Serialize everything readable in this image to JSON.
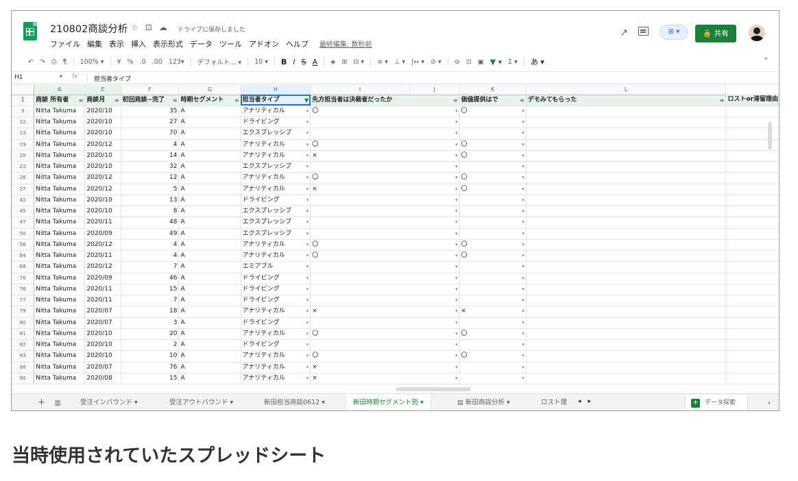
{
  "header": {
    "doc_title": "210802商談分析",
    "saved_note": "ドライブに保存しました",
    "menus": [
      "ファイル",
      "編集",
      "表示",
      "挿入",
      "表示形式",
      "データ",
      "ツール",
      "アドオン",
      "ヘルプ"
    ],
    "last_edit": "最終編集: 数秒前",
    "share_label": "共有",
    "icons": {
      "star": "star-icon",
      "move": "folder-icon",
      "cloud": "cloud-saved-icon",
      "trend": "activity-trend-icon",
      "comment": "comment-icon",
      "present": "present-icon"
    }
  },
  "toolbar": {
    "zoom": "100%",
    "currency": "¥",
    "percent": "%",
    "dec_less": ".0",
    "dec_more": ".00",
    "format": "123",
    "font": "デフォルト...",
    "font_size": "10",
    "bold": "B",
    "italic": "I",
    "strike": "S",
    "text_color": "A",
    "ime": "あ"
  },
  "formula_bar": {
    "cell_ref": "H1",
    "fx": "fx",
    "content": "担当者タイプ"
  },
  "grid": {
    "columns": [
      "A",
      "E",
      "F",
      "G",
      "H",
      "I",
      "J",
      "K",
      "L"
    ],
    "headers": [
      "商談 所有者",
      "商談月",
      "初回商談~完了",
      "時期セグメント",
      "担当者タイプ",
      "先方担当者は決裁者だったか",
      "価値提供はで",
      "デモみてもらった",
      "ロストor滞留理由"
    ],
    "rows": [
      {
        "n": "3",
        "owner": "Nitta Takuma",
        "month": "2020/10",
        "days": "35",
        "seg": "A",
        "type": "アナリティカル",
        "decision": "〇",
        "value": "〇"
      },
      {
        "n": "12",
        "owner": "Nitta Takuma",
        "month": "2020/10",
        "days": "27",
        "seg": "A",
        "type": "ドライビング",
        "decision": "",
        "value": ""
      },
      {
        "n": "13",
        "owner": "Nitta Takuma",
        "month": "2020/10",
        "days": "70",
        "seg": "A",
        "type": "エクスプレッシブ",
        "decision": "",
        "value": ""
      },
      {
        "n": "19",
        "owner": "Nitta Takuma",
        "month": "2020/12",
        "days": "4",
        "seg": "A",
        "type": "アナリティカル",
        "decision": "〇",
        "value": "〇"
      },
      {
        "n": "20",
        "owner": "Nitta Takuma",
        "month": "2020/10",
        "days": "14",
        "seg": "A",
        "type": "アナリティカル",
        "decision": "×",
        "value": "〇"
      },
      {
        "n": "22",
        "owner": "Nitta Takuma",
        "month": "2020/10",
        "days": "32",
        "seg": "A",
        "type": "エクスプレッシブ",
        "decision": "",
        "value": ""
      },
      {
        "n": "26",
        "owner": "Nitta Takuma",
        "month": "2020/12",
        "days": "12",
        "seg": "A",
        "type": "アナリティカル",
        "decision": "〇",
        "value": "〇"
      },
      {
        "n": "27",
        "owner": "Nitta Takuma",
        "month": "2020/12",
        "days": "5",
        "seg": "A",
        "type": "アナリティカル",
        "decision": "×",
        "value": "〇"
      },
      {
        "n": "42",
        "owner": "Nitta Takuma",
        "month": "2020/10",
        "days": "13",
        "seg": "A",
        "type": "ドライビング",
        "decision": "",
        "value": ""
      },
      {
        "n": "45",
        "owner": "Nitta Takuma",
        "month": "2020/10",
        "days": "8",
        "seg": "A",
        "type": "エクスプレッシブ",
        "decision": "",
        "value": ""
      },
      {
        "n": "47",
        "owner": "Nitta Takuma",
        "month": "2020/11",
        "days": "48",
        "seg": "A",
        "type": "エクスプレッシブ",
        "decision": "",
        "value": ""
      },
      {
        "n": "50",
        "owner": "Nitta Takuma",
        "month": "2020/09",
        "days": "49",
        "seg": "A",
        "type": "エクスプレッシブ",
        "decision": "",
        "value": ""
      },
      {
        "n": "56",
        "owner": "Nitta Takuma",
        "month": "2020/12",
        "days": "4",
        "seg": "A",
        "type": "アナリティカル",
        "decision": "〇",
        "value": "〇"
      },
      {
        "n": "64",
        "owner": "Nitta Takuma",
        "month": "2020/11",
        "days": "4",
        "seg": "A",
        "type": "アナリティカル",
        "decision": "〇",
        "value": "〇"
      },
      {
        "n": "68",
        "owner": "Nitta Takuma",
        "month": "2020/12",
        "days": "7",
        "seg": "A",
        "type": "エミアブル",
        "decision": "",
        "value": ""
      },
      {
        "n": "70",
        "owner": "Nitta Takuma",
        "month": "2020/09",
        "days": "46",
        "seg": "A",
        "type": "ドライビング",
        "decision": "",
        "value": ""
      },
      {
        "n": "76",
        "owner": "Nitta Takuma",
        "month": "2020/11",
        "days": "15",
        "seg": "A",
        "type": "ドライビング",
        "decision": "",
        "value": ""
      },
      {
        "n": "77",
        "owner": "Nitta Takuma",
        "month": "2020/11",
        "days": "7",
        "seg": "A",
        "type": "ドライビング",
        "decision": "",
        "value": ""
      },
      {
        "n": "79",
        "owner": "Nitta Takuma",
        "month": "2020/07",
        "days": "18",
        "seg": "A",
        "type": "アナリティカル",
        "decision": "×",
        "value": "×"
      },
      {
        "n": "80",
        "owner": "Nitta Takuma",
        "month": "2020/07",
        "days": "3",
        "seg": "A",
        "type": "ドライビング",
        "decision": "",
        "value": ""
      },
      {
        "n": "81",
        "owner": "Nitta Takuma",
        "month": "2020/10",
        "days": "20",
        "seg": "A",
        "type": "アナリティカル",
        "decision": "〇",
        "value": "〇"
      },
      {
        "n": "82",
        "owner": "Nitta Takuma",
        "month": "2020/10",
        "days": "2",
        "seg": "A",
        "type": "ドライビング",
        "decision": "",
        "value": ""
      },
      {
        "n": "83",
        "owner": "Nitta Takuma",
        "month": "2020/10",
        "days": "10",
        "seg": "A",
        "type": "アナリティカル",
        "decision": "〇",
        "value": "〇"
      },
      {
        "n": "86",
        "owner": "Nitta Takuma",
        "month": "2020/07",
        "days": "76",
        "seg": "A",
        "type": "アナリティカル",
        "decision": "×",
        "value": ""
      },
      {
        "n": "90",
        "owner": "Nitta Takuma",
        "month": "2020/08",
        "days": "15",
        "seg": "A",
        "type": "アナリティカル",
        "decision": "×",
        "value": ""
      }
    ]
  },
  "sheets": {
    "tabs": [
      {
        "label": "受注インバウンド",
        "active": false
      },
      {
        "label": "受注アウトバウンド",
        "active": false
      },
      {
        "label": "新田担当商談0612",
        "active": false
      },
      {
        "label": "新田時期セグメント別",
        "active": true
      },
      {
        "label": "新田商談分析",
        "active": false
      },
      {
        "label": "ロスト理",
        "active": false
      }
    ],
    "explore_label": "データ探索"
  },
  "caption": "当時使用されていたスプレッドシート",
  "colors": {
    "brand_green": "#0f9d58",
    "share_green": "#188038",
    "selection_blue": "#1a73e8",
    "header_fill": "#e6f4ea"
  }
}
